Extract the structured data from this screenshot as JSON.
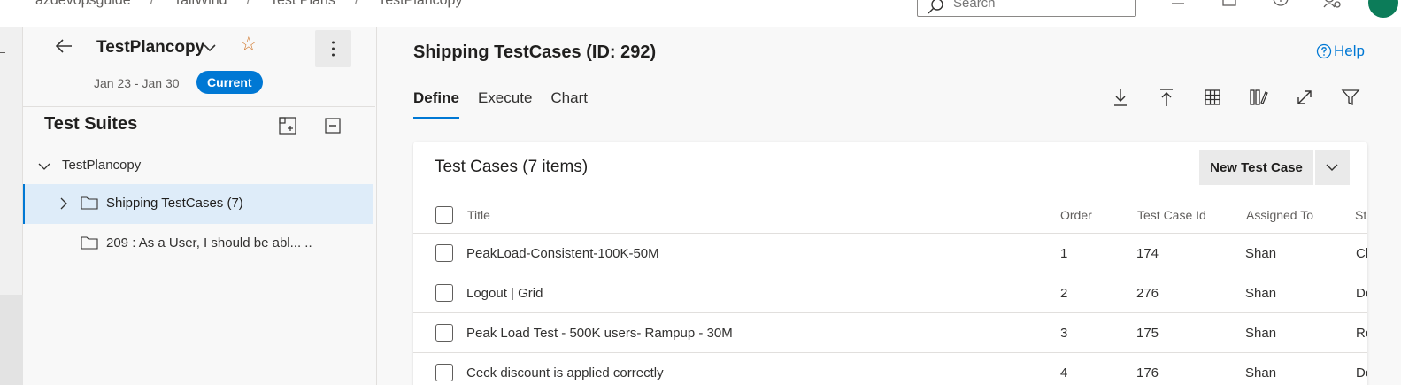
{
  "breadcrumb": [
    "azdevopsguide",
    "TailWind",
    "Test Plans",
    "TestPlancopy"
  ],
  "search": {
    "placeholder": "Search"
  },
  "top_icons": [
    "list-icon",
    "clipboard-icon",
    "help-icon",
    "user-settings-icon"
  ],
  "plan": {
    "name": "TestPlancopy",
    "dates": "Jan 23 - Jan 30",
    "badge": "Current"
  },
  "suites": {
    "title": "Test Suites",
    "root": "TestPlancopy",
    "items": [
      {
        "label": "Shipping TestCases (7)",
        "selected": true
      },
      {
        "label": "209 : As a User, I should be abl... .."
      }
    ]
  },
  "main": {
    "title": "Shipping TestCases (ID: 292)",
    "help": "Help",
    "tabs": [
      "Define",
      "Execute",
      "Chart"
    ],
    "active_tab": "Define",
    "toolbar": [
      "download-icon",
      "upload-icon",
      "grid-icon",
      "columns-icon",
      "fullscreen-icon",
      "filter-icon"
    ]
  },
  "testcases": {
    "title": "Test Cases (7 items)",
    "new_button": "New Test Case",
    "columns": [
      "Title",
      "Order",
      "Test Case Id",
      "Assigned To",
      "St"
    ],
    "rows": [
      {
        "title": "PeakLoad-Consistent-100K-50M",
        "order": "1",
        "id": "174",
        "assigned": "Shan",
        "state": "Cl"
      },
      {
        "title": "Logout | Grid",
        "order": "2",
        "id": "276",
        "assigned": "Shan",
        "state": "De"
      },
      {
        "title": "Peak Load Test - 500K users- Rampup - 30M",
        "order": "3",
        "id": "175",
        "assigned": "Shan",
        "state": "Re"
      },
      {
        "title": "Ceck discount is applied correctly",
        "order": "4",
        "id": "176",
        "assigned": "Shan",
        "state": "De"
      }
    ]
  },
  "colors": {
    "accent": "#0078d4",
    "star": "#d0792f",
    "selected_bg": "#deecf9",
    "avatar": "#0c7c59"
  }
}
